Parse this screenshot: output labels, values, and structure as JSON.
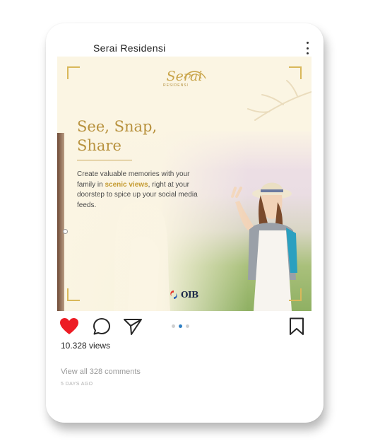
{
  "post": {
    "username": "Serai Residensi",
    "image": {
      "logo_main": "Serai",
      "logo_sub": "RESIDENSI",
      "headline": [
        "See, Snap,",
        "Share"
      ],
      "body_before": "Create valuable memories with your family in ",
      "body_highlight": "scenic views",
      "body_after": ", right at your doorstep to spice up your social media feeds.",
      "sponsor": "OIB"
    },
    "carousel": {
      "count": 3,
      "active_index": 1
    },
    "liked": true,
    "views": "10.328 views",
    "comments_link": "View all 328 comments",
    "time": "5 DAYS AGO"
  },
  "colors": {
    "heart": "#ed1c24",
    "gold": "#b8923e",
    "active_dot": "#2e7fc4",
    "cream": "#fbf5e3"
  },
  "icons": [
    "more-options-icon",
    "heart-icon",
    "comment-icon",
    "share-icon",
    "bookmark-icon",
    "oib-logo-icon"
  ]
}
